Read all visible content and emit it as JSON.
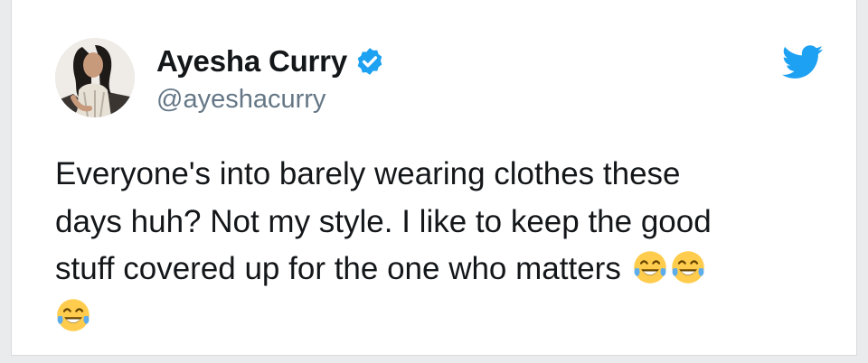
{
  "author": {
    "name": "Ayesha Curry",
    "handle": "@ayeshacurry",
    "verified": true,
    "avatar_icon": "profile-photo"
  },
  "tweet": {
    "lines": [
      "Everyone's into barely wearing clothes these",
      "days huh? Not my style. I like to keep the good",
      "stuff covered up for the one who matters"
    ],
    "emoji": [
      "face-with-tears-of-joy",
      "face-with-tears-of-joy",
      "face-with-tears-of-joy"
    ]
  },
  "icons": {
    "brand": "twitter-bird-icon",
    "verified": "verified-badge-icon"
  },
  "colors": {
    "brand_blue": "#1da1f2",
    "name": "#14171a",
    "handle": "#657786",
    "emoji_face": "#ffcc4d",
    "emoji_tear": "#5dadec"
  }
}
